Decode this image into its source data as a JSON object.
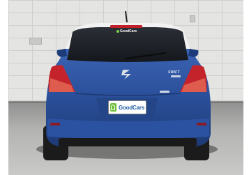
{
  "photo": {
    "subject": "Suzuki Swift rear view",
    "car_color": "#2a4f99",
    "model_badge": "SWIFT",
    "dealer_plate_text": "GoodCars",
    "window_banner_text": "GoodCars",
    "brand_color": "#6fbf3a"
  }
}
